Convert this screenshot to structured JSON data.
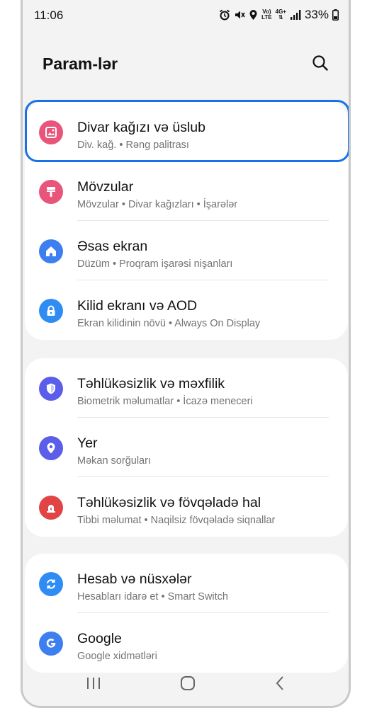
{
  "status_bar": {
    "time": "11:06",
    "network_top": "Vo)",
    "network_bottom": "LTE",
    "gen_top": "4G+",
    "battery": "33%"
  },
  "header": {
    "title": "Param-lər",
    "search_icon": "search-icon"
  },
  "groups": [
    {
      "items": [
        {
          "title": "Divar kağızı və üslub",
          "subtitle": "Div. kağ.  •  Rəng palitrası",
          "icon": "wallpaper-icon",
          "color": "#e8547a"
        },
        {
          "title": "Mövzular",
          "subtitle": "Mövzular  •  Divar kağızları  •  İşarələr",
          "icon": "themes-icon",
          "color": "#e8547a"
        },
        {
          "title": "Əsas ekran",
          "subtitle": "Düzüm  •  Proqram işarəsi nişanları",
          "icon": "home-icon",
          "color": "#3d7ff0"
        },
        {
          "title": "Kilid ekranı və AOD",
          "subtitle": "Ekran kilidinin növü  •  Always On Display",
          "icon": "lock-icon",
          "color": "#2f8cf5"
        }
      ]
    },
    {
      "items": [
        {
          "title": "Təhlükəsizlik və məxfilik",
          "subtitle": "Biometrik məlumatlar  •  İcazə meneceri",
          "icon": "shield-icon",
          "color": "#5a5ee8"
        },
        {
          "title": "Yer",
          "subtitle": "Məkan sorğuları",
          "icon": "location-pin-icon",
          "color": "#5a5ee8"
        },
        {
          "title": "Təhlükəsizlik və fövqəladə hal",
          "subtitle": "Tibbi məlumat  •  Naqilsiz fövqəladə siqnallar",
          "icon": "emergency-icon",
          "color": "#e04444"
        }
      ]
    },
    {
      "items": [
        {
          "title": "Hesab və nüsxələr",
          "subtitle": "Hesabları idarə et  •  Smart Switch",
          "icon": "sync-icon",
          "color": "#2f8cf5"
        },
        {
          "title": "Google",
          "subtitle": "Google xidmətləri",
          "icon": "google-icon",
          "color": "#3d7ff0"
        }
      ]
    }
  ],
  "nav_bar": {
    "recents": "recents-icon",
    "home": "home-button-icon",
    "back": "back-icon"
  }
}
